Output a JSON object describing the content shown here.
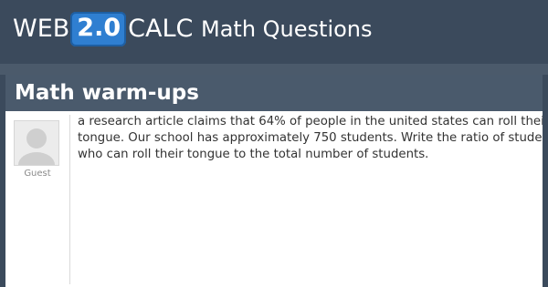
{
  "header": {
    "logo_web": "WEB",
    "logo_version": "2.0",
    "logo_calc": "CALC",
    "section_title": "Math Questions"
  },
  "page": {
    "title": "Math warm-ups"
  },
  "post": {
    "user_name": "Guest",
    "avatar_icon": "user-avatar-placeholder-icon",
    "question": "a research article claims that 64% of people in the united states can roll their tongue. Our school has approximately 750 students. Write the ratio of students who can roll their tongue to the total number of students."
  },
  "colors": {
    "header_bg": "#3b4a5c",
    "logo_badge": "#2f7fd1",
    "title_bar_bg": "#4a5a6c",
    "text": "#333333"
  }
}
